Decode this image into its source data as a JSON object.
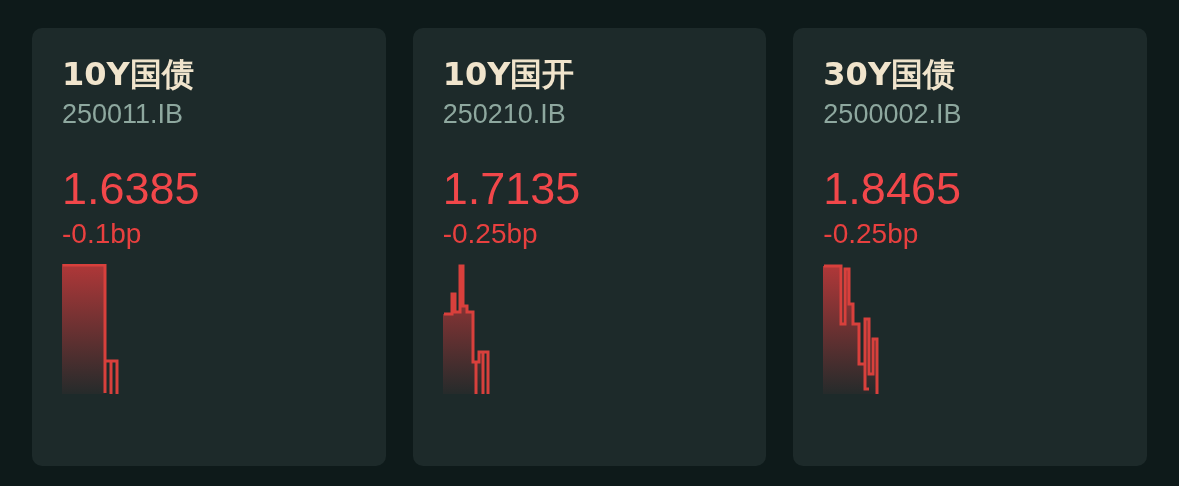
{
  "cards": [
    {
      "title": "10Y国债",
      "code": "250011.IB",
      "price": "1.6385",
      "change": "-0.1bp"
    },
    {
      "title": "10Y国开",
      "code": "250210.IB",
      "price": "1.7135",
      "change": "-0.25bp"
    },
    {
      "title": "30Y国债",
      "code": "2500002.IB",
      "price": "1.8465",
      "change": "-0.25bp"
    }
  ]
}
